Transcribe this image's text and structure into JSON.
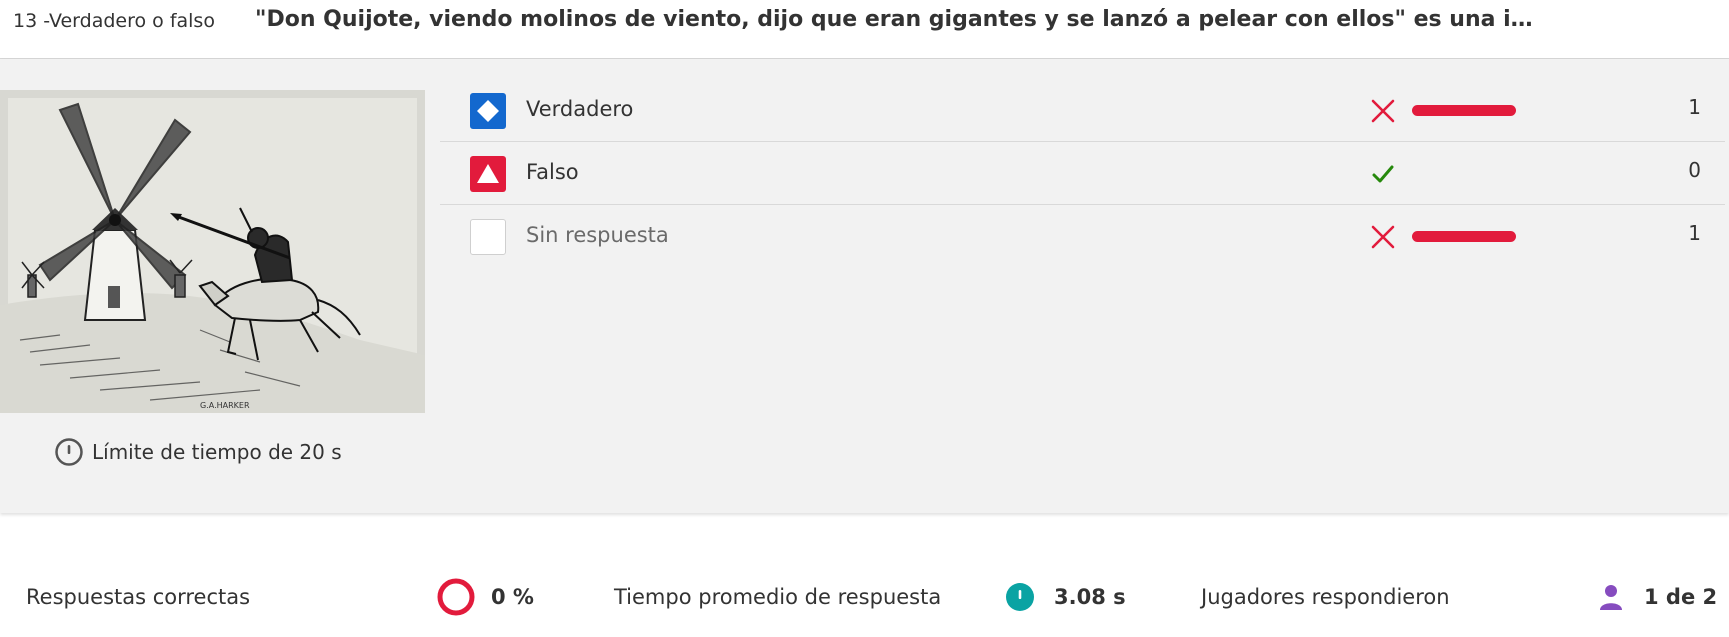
{
  "question": {
    "index_label": "13 -Verdadero o falso",
    "title": "\"Don Quijote, viendo molinos de viento, dijo que eran gigantes y se lanzó a pelear con ellos\" es una in…"
  },
  "image": {
    "signature": "G.A.HARKER"
  },
  "time_limit": {
    "icon": "clock-icon",
    "label": "Límite de tiempo de 20 s"
  },
  "answers": [
    {
      "label": "Verdadero",
      "shape": "diamond",
      "color": "#1368ce",
      "result": "incorrect",
      "count": "1",
      "share": 1.0
    },
    {
      "label": "Falso",
      "shape": "triangle",
      "color": "#e21b3c",
      "result": "correct",
      "count": "0",
      "share": 0.0
    },
    {
      "label": "Sin respuesta",
      "shape": "none",
      "color": "#ffffff",
      "result": "incorrect",
      "count": "1",
      "share": 1.0
    }
  ],
  "colors": {
    "incorrect": "#e21b3c",
    "correct": "#26890c",
    "panel_bg": "#f2f2f2",
    "time_accent": "#0aa3a3",
    "player_accent": "#864cbf"
  },
  "stats": {
    "correct_label": "Respuestas correctas",
    "correct_value": "0 %",
    "avg_time_label": "Tiempo promedio de respuesta",
    "avg_time_value": "3.08 s",
    "players_label": "Jugadores respondieron",
    "players_value": "1 de 2"
  }
}
